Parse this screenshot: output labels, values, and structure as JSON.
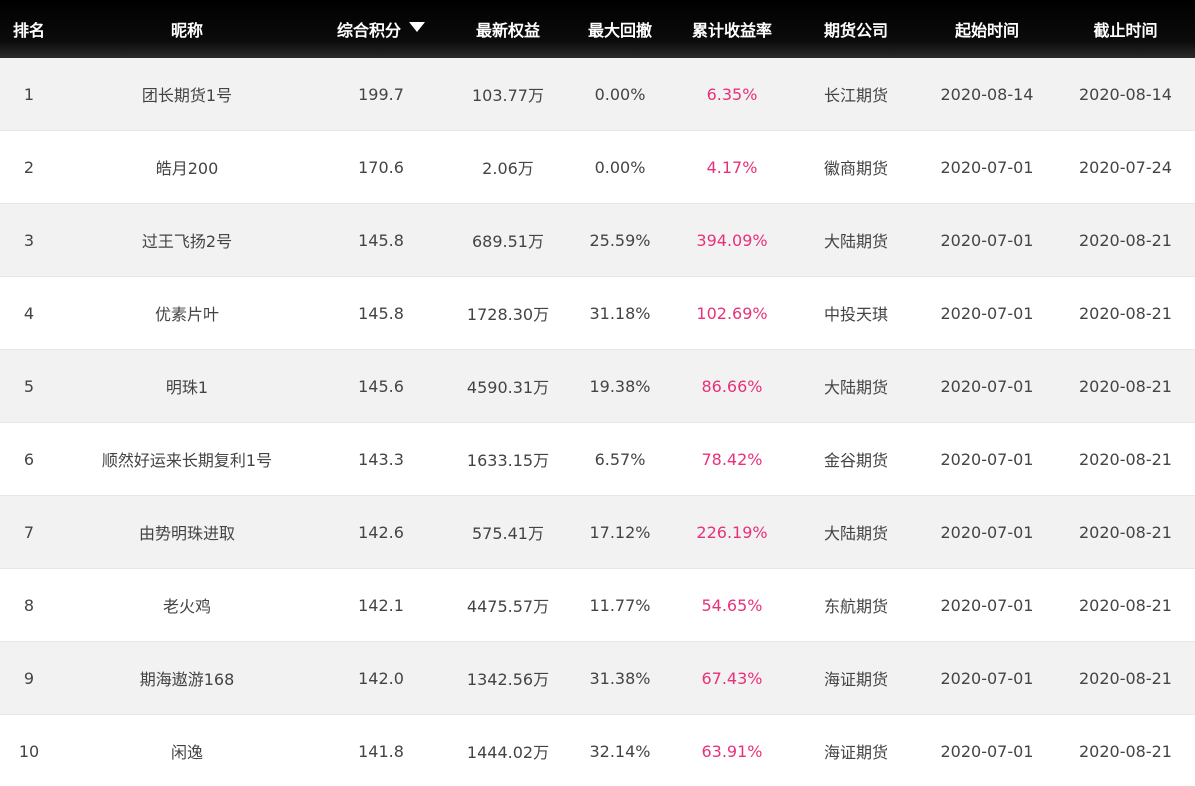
{
  "header": {
    "rank": "排名",
    "name": "昵称",
    "score": "综合积分",
    "equity": "最新权益",
    "drawdown": "最大回撤",
    "return": "累计收益率",
    "company": "期货公司",
    "start": "起始时间",
    "end": "截止时间"
  },
  "colors": {
    "header_bg": "#000000",
    "return_text": "#e8317a",
    "stripe": "#f2f2f2"
  },
  "sort_icon": "caret-down-icon",
  "rows": [
    {
      "rank": "1",
      "name": "团长期货1号",
      "score": "199.7",
      "equity": "103.77万",
      "drawdown": "0.00%",
      "return": "6.35%",
      "company": "长江期货",
      "start": "2020-08-14",
      "end": "2020-08-14"
    },
    {
      "rank": "2",
      "name": "皓月200",
      "score": "170.6",
      "equity": "2.06万",
      "drawdown": "0.00%",
      "return": "4.17%",
      "company": "徽商期货",
      "start": "2020-07-01",
      "end": "2020-07-24"
    },
    {
      "rank": "3",
      "name": "过王飞扬2号",
      "score": "145.8",
      "equity": "689.51万",
      "drawdown": "25.59%",
      "return": "394.09%",
      "company": "大陆期货",
      "start": "2020-07-01",
      "end": "2020-08-21"
    },
    {
      "rank": "4",
      "name": "优素片叶",
      "score": "145.8",
      "equity": "1728.30万",
      "drawdown": "31.18%",
      "return": "102.69%",
      "company": "中投天琪",
      "start": "2020-07-01",
      "end": "2020-08-21"
    },
    {
      "rank": "5",
      "name": "明珠1",
      "score": "145.6",
      "equity": "4590.31万",
      "drawdown": "19.38%",
      "return": "86.66%",
      "company": "大陆期货",
      "start": "2020-07-01",
      "end": "2020-08-21"
    },
    {
      "rank": "6",
      "name": "顺然好运来长期复利1号",
      "score": "143.3",
      "equity": "1633.15万",
      "drawdown": "6.57%",
      "return": "78.42%",
      "company": "金谷期货",
      "start": "2020-07-01",
      "end": "2020-08-21"
    },
    {
      "rank": "7",
      "name": "由势明珠进取",
      "score": "142.6",
      "equity": "575.41万",
      "drawdown": "17.12%",
      "return": "226.19%",
      "company": "大陆期货",
      "start": "2020-07-01",
      "end": "2020-08-21"
    },
    {
      "rank": "8",
      "name": "老火鸡",
      "score": "142.1",
      "equity": "4475.57万",
      "drawdown": "11.77%",
      "return": "54.65%",
      "company": "东航期货",
      "start": "2020-07-01",
      "end": "2020-08-21"
    },
    {
      "rank": "9",
      "name": "期海遨游168",
      "score": "142.0",
      "equity": "1342.56万",
      "drawdown": "31.38%",
      "return": "67.43%",
      "company": "海证期货",
      "start": "2020-07-01",
      "end": "2020-08-21"
    },
    {
      "rank": "10",
      "name": "闲逸",
      "score": "141.8",
      "equity": "1444.02万",
      "drawdown": "32.14%",
      "return": "63.91%",
      "company": "海证期货",
      "start": "2020-07-01",
      "end": "2020-08-21"
    }
  ]
}
